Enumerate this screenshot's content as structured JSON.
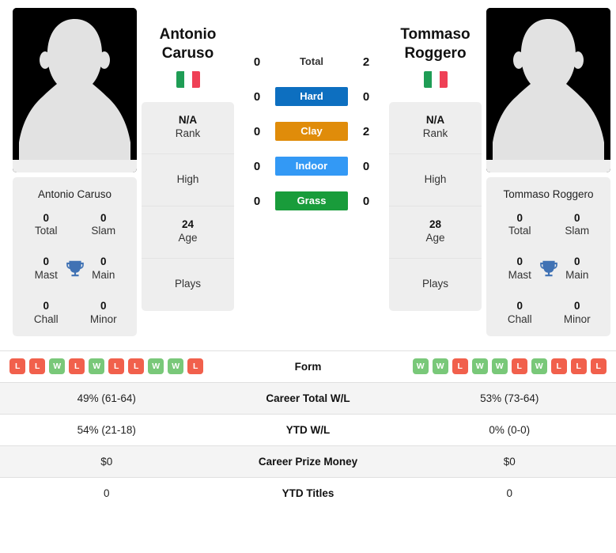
{
  "players": {
    "left": {
      "first_name": "Antonio",
      "last_name": "Caruso",
      "full_name": "Antonio Caruso",
      "flag": {
        "name": "italy-flag",
        "colors": [
          "#1f9d55",
          "#ffffff",
          "#ef4056"
        ]
      },
      "avatar": "player-avatar-placeholder",
      "titles": [
        {
          "value": "0",
          "label": "Total"
        },
        {
          "value": "0",
          "label": "Slam"
        },
        {
          "value": "0",
          "label": "Mast"
        },
        {
          "value": "0",
          "label": "Main"
        },
        {
          "value": "0",
          "label": "Chall"
        },
        {
          "value": "0",
          "label": "Minor"
        }
      ],
      "info": [
        {
          "value": "N/A",
          "label": "Rank"
        },
        {
          "value": "",
          "label": "High"
        },
        {
          "value": "24",
          "label": "Age"
        },
        {
          "value": "",
          "label": "Plays"
        }
      ],
      "form": [
        "L",
        "L",
        "W",
        "L",
        "W",
        "L",
        "L",
        "W",
        "W",
        "L"
      ],
      "career_total_wl": "49% (61-64)",
      "ytd_wl": "54% (21-18)",
      "career_prize_money": "$0",
      "ytd_titles": "0"
    },
    "right": {
      "first_name": "Tommaso",
      "last_name": "Roggero",
      "full_name": "Tommaso Roggero",
      "flag": {
        "name": "italy-flag",
        "colors": [
          "#1f9d55",
          "#ffffff",
          "#ef4056"
        ]
      },
      "avatar": "player-avatar-placeholder",
      "titles": [
        {
          "value": "0",
          "label": "Total"
        },
        {
          "value": "0",
          "label": "Slam"
        },
        {
          "value": "0",
          "label": "Mast"
        },
        {
          "value": "0",
          "label": "Main"
        },
        {
          "value": "0",
          "label": "Chall"
        },
        {
          "value": "0",
          "label": "Minor"
        }
      ],
      "info": [
        {
          "value": "N/A",
          "label": "Rank"
        },
        {
          "value": "",
          "label": "High"
        },
        {
          "value": "28",
          "label": "Age"
        },
        {
          "value": "",
          "label": "Plays"
        }
      ],
      "form": [
        "W",
        "W",
        "L",
        "W",
        "W",
        "L",
        "W",
        "L",
        "L",
        "L"
      ],
      "career_total_wl": "53% (73-64)",
      "ytd_wl": "0% (0-0)",
      "career_prize_money": "$0",
      "ytd_titles": "0"
    }
  },
  "head_to_head": [
    {
      "surface": "Total",
      "left": "0",
      "right": "2",
      "color": "",
      "style": "plain"
    },
    {
      "surface": "Hard",
      "left": "0",
      "right": "0",
      "color": "#0d6fc0",
      "style": "pill"
    },
    {
      "surface": "Clay",
      "left": "0",
      "right": "2",
      "color": "#e08c0a",
      "style": "pill"
    },
    {
      "surface": "Indoor",
      "left": "0",
      "right": "0",
      "color": "#3399f5",
      "style": "pill"
    },
    {
      "surface": "Grass",
      "left": "0",
      "right": "0",
      "color": "#199c3b",
      "style": "pill"
    }
  ],
  "stats_rows": [
    {
      "label": "Form",
      "type": "form",
      "shaded": false
    },
    {
      "label": "Career Total W/L",
      "type": "text",
      "left": "49% (61-64)",
      "right": "53% (73-64)",
      "shaded": true
    },
    {
      "label": "YTD W/L",
      "type": "text",
      "left": "54% (21-18)",
      "right": "0% (0-0)",
      "shaded": false
    },
    {
      "label": "Career Prize Money",
      "type": "text",
      "left": "$0",
      "right": "$0",
      "shaded": true
    },
    {
      "label": "YTD Titles",
      "type": "text",
      "left": "0",
      "right": "0",
      "shaded": false
    }
  ],
  "theme": {
    "card_bg": "#eeeeee",
    "shaded_row": "#f4f4f4",
    "win_color": "#79c879",
    "loss_color": "#f1604c",
    "trophy_color": "#4072b4"
  }
}
